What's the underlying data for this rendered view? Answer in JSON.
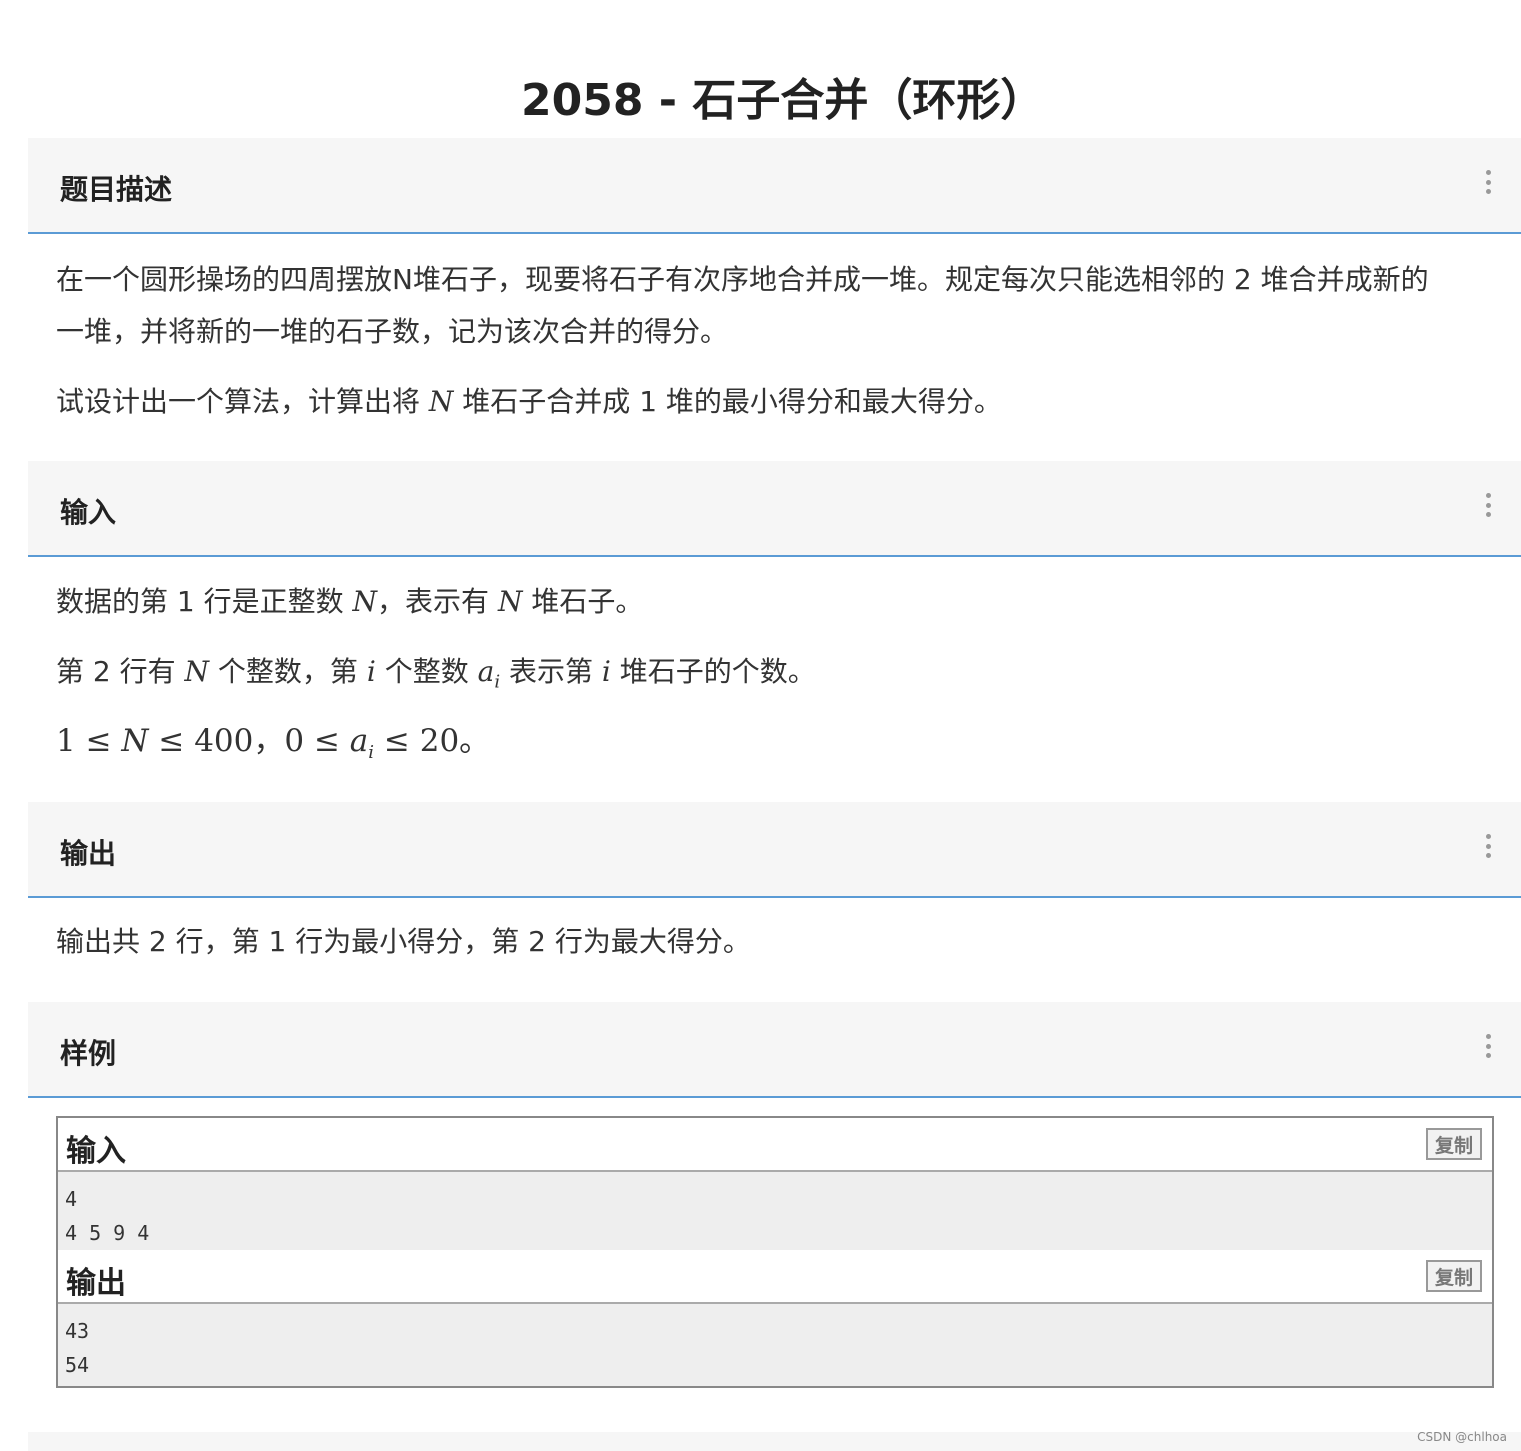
{
  "page_title": "2058 - 石子合并（环形）",
  "sections": {
    "description": {
      "label": "题目描述"
    },
    "input": {
      "label": "输入"
    },
    "output": {
      "label": "输出"
    },
    "sample": {
      "label": "样例"
    }
  },
  "description": {
    "p1_line1": "在一个圆形操场的四周摆放N堆石子，现要将石子有次序地合并成一堆。规定每次只能选相邻的 2 堆合并成新的",
    "p1_line2": "一堆，并将新的一堆的石子数，记为该次合并的得分。",
    "p2_a": "试设计出一个算法，计算出将 ",
    "p2_N": "N",
    "p2_b": " 堆石子合并成 1 堆的最小得分和最大得分。"
  },
  "input_desc": {
    "l1_a": "数据的第 1 行是正整数 ",
    "l1_N": "N",
    "l1_b": "，表示有 ",
    "l1_N2": "N",
    "l1_c": " 堆石子。",
    "l2_a": "第 2 行有 ",
    "l2_N": "N",
    "l2_b": " 个整数，第 ",
    "l2_i": "i",
    "l2_c": " 个整数 ",
    "l2_a_var": "a",
    "l2_sub": "i",
    "l2_d": " 表示第 ",
    "l2_i2": "i",
    "l2_e": " 堆石子的个数。",
    "l3_a": "1 ≤ ",
    "l3_N": "N",
    "l3_b": " ≤ 400，0 ≤ ",
    "l3_a_var": "a",
    "l3_sub": "i",
    "l3_c": " ≤ 20。"
  },
  "output_desc": "输出共 2 行，第 1 行为最小得分，第 2 行为最大得分。",
  "sample": {
    "input_title": "输入",
    "input_body": "4\n4 5 9 4",
    "output_title": "输出",
    "output_body": "43\n54",
    "copy_label": "复制"
  },
  "watermark": "CSDN @chlhoa",
  "colors": {
    "accent_line": "#5b9bd5",
    "header_bg": "#f6f6f6",
    "sample_bg": "#eeeeee"
  }
}
